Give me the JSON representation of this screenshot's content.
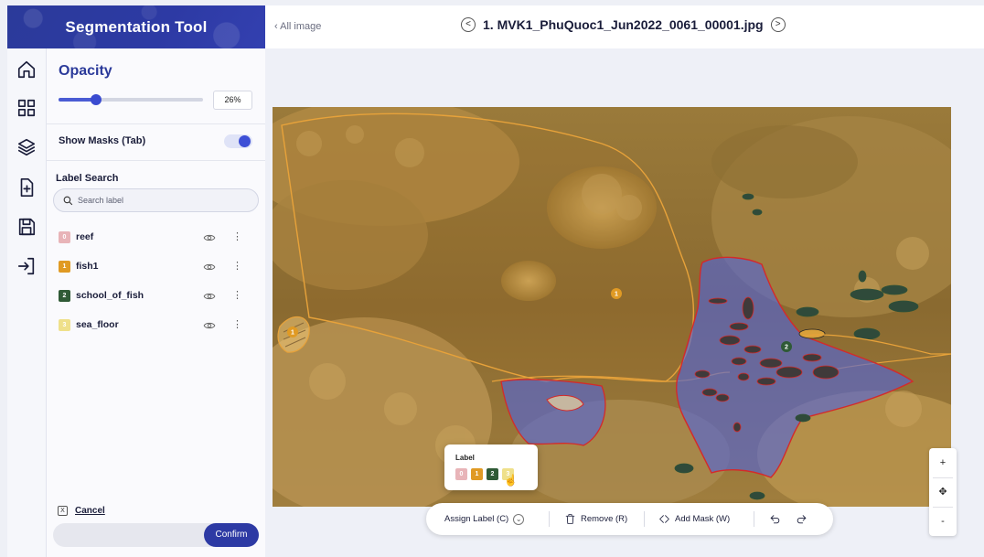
{
  "app": {
    "title": "Segmentation Tool"
  },
  "nav": {
    "back_label": "All image",
    "prev_label": "<",
    "next_label": ">",
    "filename": "1. MVK1_PhuQuoc1_Jun2022_0061_00001.jpg"
  },
  "rail": {
    "icons": [
      "home-icon",
      "grid-icon",
      "layers-icon",
      "add-file-icon",
      "save-icon",
      "logout-icon"
    ]
  },
  "opacity": {
    "title": "Opacity",
    "value_label": "26%",
    "value": 0.26
  },
  "masks": {
    "label": "Show Masks (Tab)",
    "enabled": true
  },
  "label_search": {
    "title": "Label Search",
    "placeholder": "Search label"
  },
  "labels": [
    {
      "id": "0",
      "name": "reef",
      "color": "#e8b4b8"
    },
    {
      "id": "1",
      "name": "fish1",
      "color": "#e09a24"
    },
    {
      "id": "2",
      "name": "school_of_fish",
      "color": "#2f5a36"
    },
    {
      "id": "3",
      "name": "sea_floor",
      "color": "#efe08a"
    }
  ],
  "actions": {
    "cancel_label": "Cancel",
    "cancel_key": "X",
    "confirm_label": "Confirm"
  },
  "label_popup": {
    "title": "Label",
    "chips": [
      "0",
      "1",
      "2",
      "3"
    ]
  },
  "toolbar": {
    "assign_label": "Assign Label (C)",
    "remove": "Remove (R)",
    "add_mask": "Add Mask (W)"
  },
  "zoom": {
    "in": "+",
    "pan": "✥",
    "out": "-"
  },
  "image_markers": [
    "1",
    "1",
    "2"
  ],
  "colors": {
    "brand": "#2d3aa4",
    "accent": "#3d4fd6"
  }
}
